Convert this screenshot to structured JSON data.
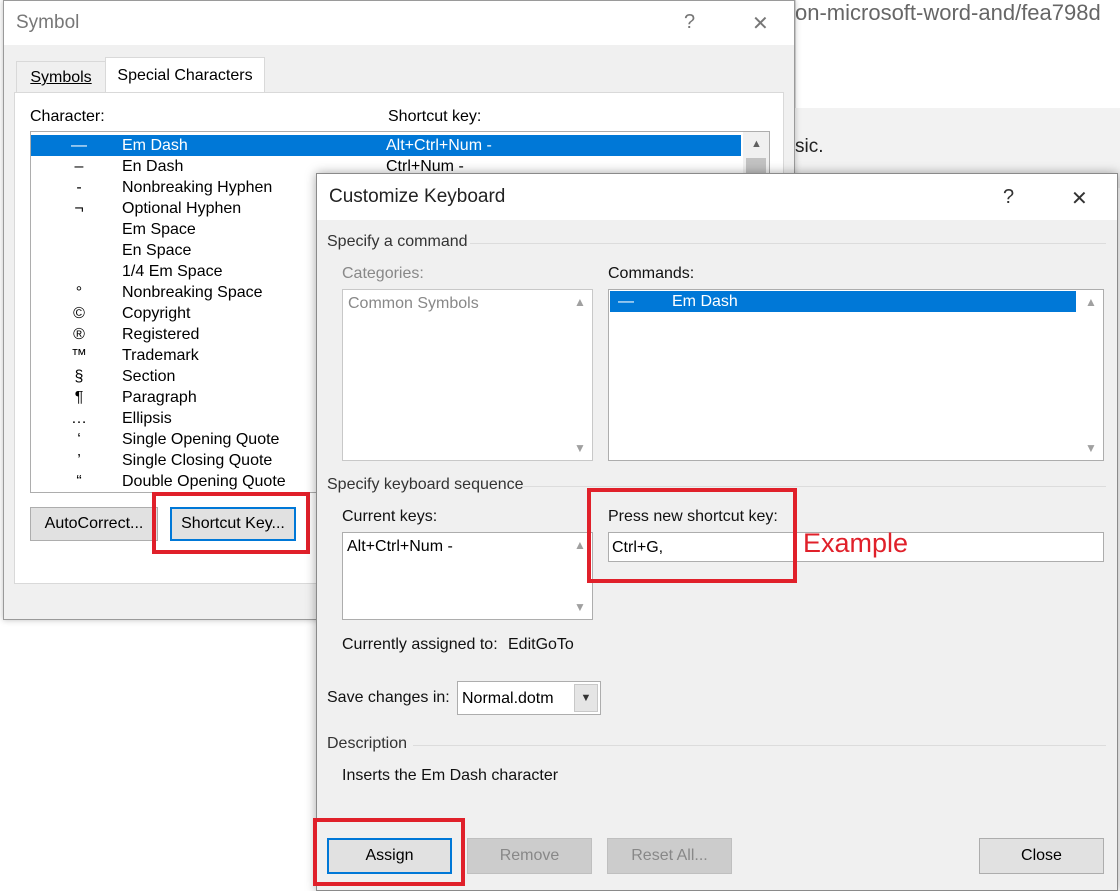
{
  "background": {
    "url_fragment": "on-microsoft-word-and/fea798d",
    "text_fragment": "sic."
  },
  "symbol_dialog": {
    "title": "Symbol",
    "help": "?",
    "close": "✕",
    "tabs": [
      "Symbols",
      "Special Characters"
    ],
    "character_header": "Character:",
    "shortcut_header": "Shortcut key:",
    "rows": [
      {
        "symbol": "—",
        "name": "Em Dash",
        "key": "Alt+Ctrl+Num -"
      },
      {
        "symbol": "–",
        "name": "En Dash",
        "key": "Ctrl+Num -"
      },
      {
        "symbol": "-",
        "name": "Nonbreaking Hyphen",
        "key": ""
      },
      {
        "symbol": "¬",
        "name": "Optional Hyphen",
        "key": ""
      },
      {
        "symbol": "",
        "name": "Em Space",
        "key": ""
      },
      {
        "symbol": "",
        "name": "En Space",
        "key": ""
      },
      {
        "symbol": "",
        "name": "1/4 Em Space",
        "key": ""
      },
      {
        "symbol": "°",
        "name": "Nonbreaking Space",
        "key": ""
      },
      {
        "symbol": "©",
        "name": "Copyright",
        "key": ""
      },
      {
        "symbol": "®",
        "name": "Registered",
        "key": ""
      },
      {
        "symbol": "™",
        "name": "Trademark",
        "key": ""
      },
      {
        "symbol": "§",
        "name": "Section",
        "key": ""
      },
      {
        "symbol": "¶",
        "name": "Paragraph",
        "key": ""
      },
      {
        "symbol": "…",
        "name": "Ellipsis",
        "key": ""
      },
      {
        "symbol": "‘",
        "name": "Single Opening Quote",
        "key": ""
      },
      {
        "symbol": "’",
        "name": "Single Closing Quote",
        "key": ""
      },
      {
        "symbol": "“",
        "name": "Double Opening Quote",
        "key": ""
      }
    ],
    "autocorrect_label": "AutoCorrect...",
    "shortcut_key_label": "Shortcut Key..."
  },
  "customize_keyboard": {
    "title": "Customize Keyboard",
    "help": "?",
    "close": "✕",
    "specify_command": "Specify a command",
    "categories_label": "Categories:",
    "categories": [
      "Common Symbols"
    ],
    "commands_label": "Commands:",
    "commands": [
      {
        "symbol": "—",
        "name": "Em Dash"
      }
    ],
    "specify_sequence": "Specify keyboard sequence",
    "current_keys_label": "Current keys:",
    "current_keys": [
      "Alt+Ctrl+Num -"
    ],
    "press_new_label": "Press new shortcut key:",
    "new_shortcut_value": "Ctrl+G,",
    "currently_assigned_label": "Currently assigned to:",
    "currently_assigned_value": "EditGoTo",
    "save_changes_label": "Save changes in:",
    "save_changes_value": "Normal.dotm",
    "description_header": "Description",
    "description_text": "Inserts the Em Dash character",
    "assign_label": "Assign",
    "remove_label": "Remove",
    "reset_all_label": "Reset All...",
    "close_label": "Close"
  },
  "annotation": {
    "example_label": "Example",
    "highlight_color": "#e0202a"
  },
  "colors": {
    "selection": "#0078d7",
    "dialog_bg": "#f0f0f0"
  }
}
